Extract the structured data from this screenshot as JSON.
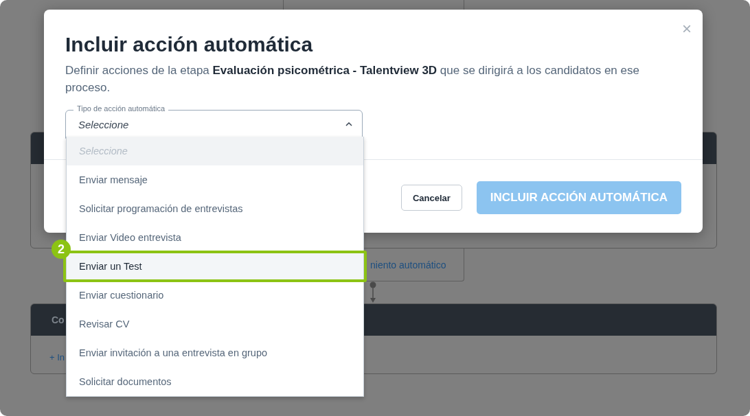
{
  "background": {
    "link_fragment": "niento automático",
    "card_header_fragment": "Co",
    "card_link_fragment": "+ In"
  },
  "modal": {
    "close": "×",
    "title": "Incluir acción automática",
    "description": "Definir acciones de la etapa **Evaluación psicométrica - Talentview 3D** que se dirigirá a los candidatos en ese proceso.",
    "field": {
      "label": "Tipo de acción automática",
      "value": "Seleccione",
      "expanded": true
    },
    "buttons": [
      {
        "label": "Cancelar",
        "kind": "secondary",
        "disabled": false
      },
      {
        "label": "INCLUIR ACCIÓN AUTOMÁTICA",
        "kind": "primary",
        "disabled": true
      }
    ]
  },
  "options": [
    {
      "label": "Seleccione",
      "kind": "placeholder",
      "selected": false
    },
    {
      "label": "Enviar mensaje",
      "kind": "option",
      "selected": false
    },
    {
      "label": "Solicitar programación de entrevistas",
      "kind": "option",
      "selected": false
    },
    {
      "label": "Enviar Video entrevista",
      "kind": "option",
      "selected": false
    },
    {
      "label": "Enviar un Test",
      "kind": "option",
      "selected": true,
      "annotation": "2"
    },
    {
      "label": "Enviar cuestionario",
      "kind": "option",
      "selected": false
    },
    {
      "label": "Revisar CV",
      "kind": "option",
      "selected": false
    },
    {
      "label": "Enviar invitación a una entrevista en grupo",
      "kind": "option",
      "selected": false
    },
    {
      "label": "Solicitar documentos",
      "kind": "option",
      "selected": false
    }
  ]
}
